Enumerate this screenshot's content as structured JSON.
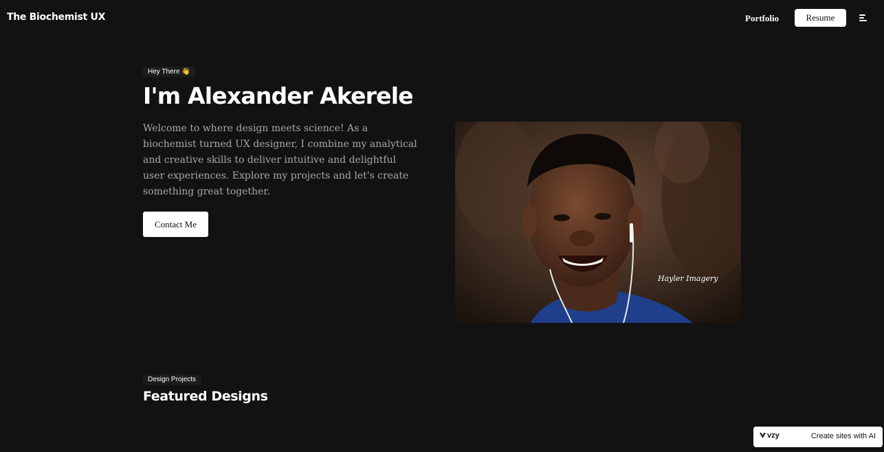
{
  "header": {
    "brand": "The Biochemist UX",
    "nav_portfolio": "Portfolio",
    "resume_label": "Resume",
    "menu_icon": "hamburger-menu-icon"
  },
  "hero": {
    "greeting": "Hey There 👋",
    "headline": "I'm Alexander Akerele",
    "intro": "Welcome to where design meets science! As a biochemist turned UX designer, I combine my analytical and creative skills to deliver intuitive and delightful user experiences. Explore my projects and let's create something great together.",
    "contact_label": "Contact Me",
    "photo_signature": "Hayler Imagery"
  },
  "featured": {
    "tag": "Design Projects",
    "title": "Featured Designs"
  },
  "badge": {
    "logo": "vzy",
    "tagline": "Create sites with AI"
  },
  "colors": {
    "background": "#121212",
    "text": "#ffffff",
    "muted_text": "#a8a8a8",
    "chip_bg": "#1c1c1c",
    "button_bg": "#ffffff"
  }
}
